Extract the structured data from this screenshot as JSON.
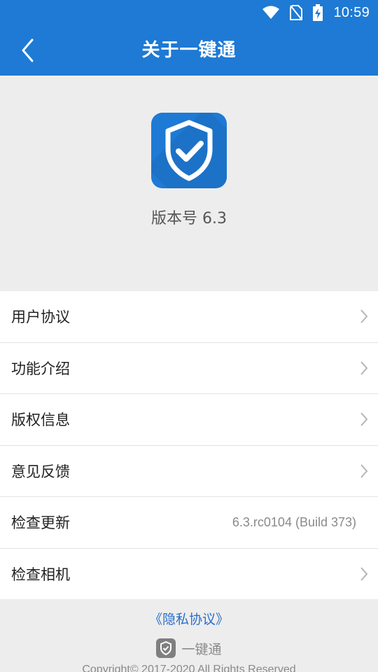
{
  "status_bar": {
    "time": "10:59",
    "icons": [
      "wifi-icon",
      "no-sim-icon",
      "battery-charging-icon"
    ]
  },
  "app_bar": {
    "title": "关于一键通",
    "back_icon": "chevron-left-icon"
  },
  "header": {
    "logo_icon": "shield-check-icon",
    "version_text": "版本号 6.3"
  },
  "menu": {
    "items": [
      {
        "label": "用户协议",
        "value": "",
        "chevron": true
      },
      {
        "label": "功能介绍",
        "value": "",
        "chevron": true
      },
      {
        "label": "版权信息",
        "value": "",
        "chevron": true
      },
      {
        "label": "意见反馈",
        "value": "",
        "chevron": true
      },
      {
        "label": "检查更新",
        "value": "6.3.rc0104 (Build 373)",
        "chevron": false
      },
      {
        "label": "检查相机",
        "value": "",
        "chevron": true
      }
    ]
  },
  "footer": {
    "privacy_link": "《隐私协议》",
    "brand_name": "一键通",
    "copyright": "Copyright© 2017-2020 All Rights Reserved"
  },
  "colors": {
    "primary": "#1e7ad4",
    "link": "#2a6fc9",
    "background": "#ededed"
  }
}
